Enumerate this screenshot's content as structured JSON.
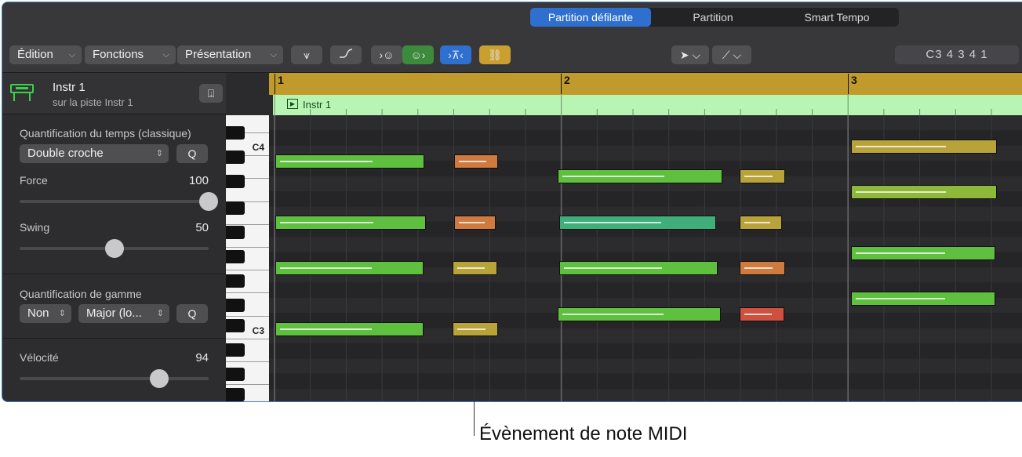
{
  "tabs": [
    {
      "label": "Partition défilante",
      "active": true
    },
    {
      "label": "Partition",
      "active": false
    },
    {
      "label": "Smart Tempo",
      "active": false
    }
  ],
  "toolbar": {
    "edit": "Édition",
    "functions": "Fonctions",
    "view": "Présentation",
    "lcd": "C3  4 3 4 1"
  },
  "track": {
    "name": "Instr 1",
    "subtitle": "sur la piste Instr 1"
  },
  "quantize": {
    "title": "Quantification du temps (classique)",
    "value": "Double croche",
    "q_label": "Q",
    "strength_label": "Force",
    "strength_value": "100",
    "strength_level": 1.0,
    "swing_label": "Swing",
    "swing_value": "50",
    "swing_level": 0.5
  },
  "scale": {
    "title": "Quantification de gamme",
    "mode": "Non",
    "scale": "Major (lo...",
    "q_label": "Q"
  },
  "velocity": {
    "label": "Vélocité",
    "value": "94",
    "level": 0.74
  },
  "keyboard": {
    "c4": "C4",
    "c3": "C3"
  },
  "ruler": {
    "bars": [
      "1",
      "2",
      "3"
    ]
  },
  "region": {
    "name": "Instr 1",
    "color": "#b8f5b4"
  },
  "callout": "Évènement de note MIDI",
  "colors": {
    "accent": "#2f6fcf",
    "ruler": "#c19a2c",
    "green": "#5fbf3f",
    "orange": "#cf7a3f",
    "yellow": "#b8a33a",
    "lime": "#8db83a",
    "red": "#d05040",
    "teal": "#3fae7a"
  }
}
